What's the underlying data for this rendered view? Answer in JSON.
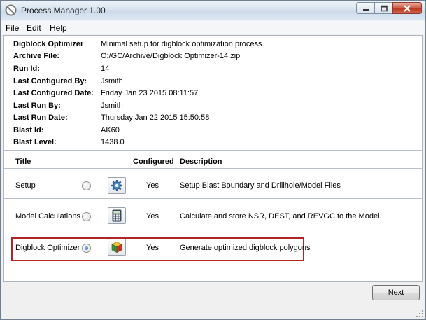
{
  "window": {
    "title": "Process Manager 1.00"
  },
  "menu": {
    "items": [
      "File",
      "Edit",
      "Help"
    ]
  },
  "info": {
    "rows": [
      {
        "label": "Digblock Optimizer",
        "value": "Minimal setup for digblock optimization process"
      },
      {
        "label": "Archive File:",
        "value": "O:/GC/Archive/Digblock Optimizer-14.zip"
      },
      {
        "label": "Run Id:",
        "value": "14"
      },
      {
        "label": "Last Configured By:",
        "value": "Jsmith"
      },
      {
        "label": "Last Configured Date:",
        "value": "Friday Jan 23 2015 08:11:57"
      },
      {
        "label": "Last Run By:",
        "value": "Jsmith"
      },
      {
        "label": "Last Run Date:",
        "value": "Thursday Jan 22 2015 15:50:58"
      },
      {
        "label": "Blast Id:",
        "value": "AK60"
      },
      {
        "label": "Blast Level:",
        "value": "1438.0"
      }
    ]
  },
  "steps_table": {
    "headers": {
      "title": "Title",
      "configured": "Configured",
      "description": "Description"
    },
    "steps": [
      {
        "title": "Setup",
        "icon": "gear-icon",
        "configured": "Yes",
        "description": "Setup Blast Boundary and Drillhole/Model Files",
        "selected": false
      },
      {
        "title": "Model Calculations",
        "icon": "calculator-icon",
        "configured": "Yes",
        "description": "Calculate and store NSR, DEST, and REVGC to the Model",
        "selected": false
      },
      {
        "title": "Digblock Optimizer",
        "icon": "cube-icon",
        "configured": "Yes",
        "description": "Generate optimized digblock polygons",
        "selected": true
      }
    ]
  },
  "footer": {
    "next_label": "Next"
  },
  "colors": {
    "highlight_border": "#b32424",
    "close_button": "#c75a45"
  }
}
